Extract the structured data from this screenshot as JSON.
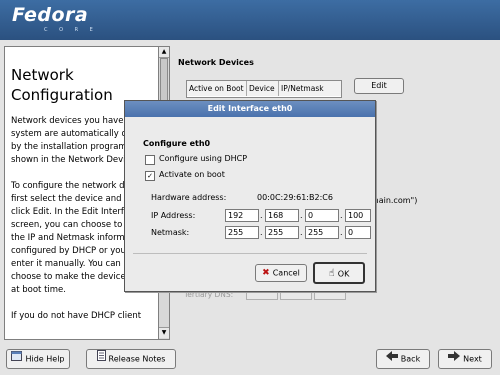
{
  "header": {
    "brand": "Fedora",
    "brand_sub": "C O R E"
  },
  "help": {
    "title": "Network Configuration",
    "para1": "Network devices you have on the system are automatically detected by the installation program and shown in the Network Devices list.",
    "para2": "To configure the network device, first select the device and then click Edit. In the Edit Interface screen, you can choose to have the IP and Netmask information configured by DHCP or you can enter it manually. You can also choose to make the device active at boot time.",
    "para3": "If you do not have DHCP client"
  },
  "background": {
    "network_devices_label": "Network Devices",
    "columns": [
      "Active on Boot",
      "Device",
      "IP/Netmask"
    ],
    "edit_button": "Edit",
    "domain_fragment": "omain.com\")",
    "tertiary_dns_label": "Tertiary DNS:"
  },
  "dialog": {
    "title": "Edit Interface eth0",
    "section": "Configure eth0",
    "dhcp_label": "Configure using DHCP",
    "dhcp_checked": false,
    "boot_label": "Activate on boot",
    "boot_checked": true,
    "hw_label": "Hardware address:",
    "hw_value": "00:0C:29:61:B2:C6",
    "ip_label": "IP Address:",
    "ip": [
      "192",
      "168",
      "0",
      "100"
    ],
    "netmask_label": "Netmask:",
    "netmask": [
      "255",
      "255",
      "255",
      "0"
    ],
    "cancel": "Cancel",
    "ok": "OK",
    "separator": "."
  },
  "bottom": {
    "hide_help": "Hide Help",
    "release_notes": "Release Notes",
    "back": "Back",
    "next": "Next"
  }
}
